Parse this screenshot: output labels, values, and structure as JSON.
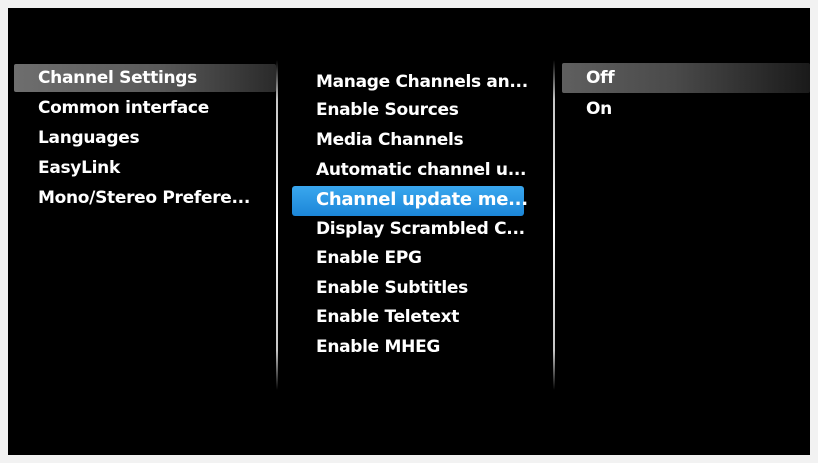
{
  "menu": {
    "level1": {
      "items": [
        "Channel Settings",
        "Common interface",
        "Languages",
        "EasyLink",
        "Mono/Stereo Prefere..."
      ]
    },
    "level2": {
      "items": [
        "Manage Channels an...",
        "Enable Sources",
        "Media Channels",
        "Automatic channel u...",
        "Channel update me...",
        "Display Scrambled C...",
        "Enable EPG",
        "Enable Subtitles",
        "Enable Teletext",
        "Enable MHEG"
      ]
    },
    "level3": {
      "items": [
        "Off",
        "On"
      ]
    }
  },
  "colors": {
    "background": "#000000",
    "selection_blue": "#2a95e3",
    "parent_highlight": "#666666"
  }
}
